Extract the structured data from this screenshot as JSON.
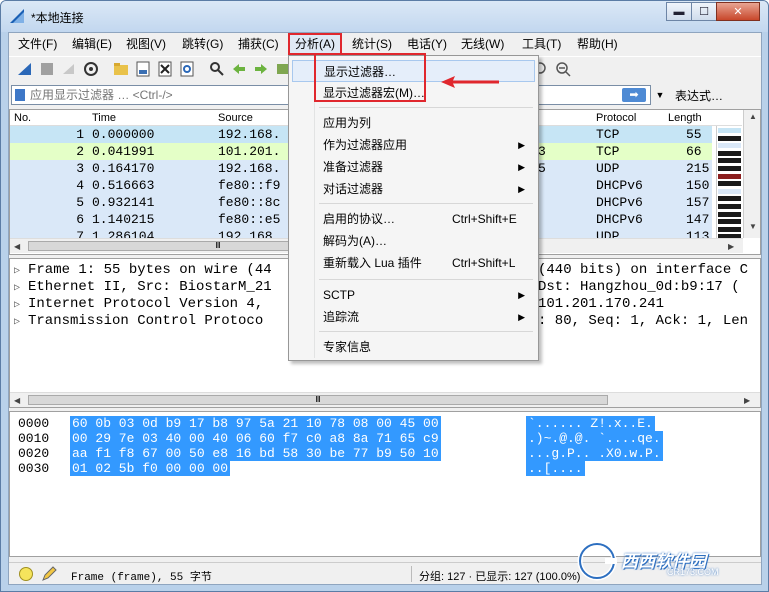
{
  "window": {
    "title": "*本地连接",
    "min": "▬",
    "max": "☐",
    "close": "✕"
  },
  "menubar": [
    "文件(F)",
    "编辑(E)",
    "视图(V)",
    "跳转(G)",
    "捕获(C)",
    "分析(A)",
    "统计(S)",
    "电话(Y)",
    "无线(W)",
    "工具(T)",
    "帮助(H)"
  ],
  "filter": {
    "placeholder": "应用显示过滤器 … <Ctrl-/>",
    "apply": "➡",
    "dropdown": "▼",
    "expression": "表达式…"
  },
  "packet_list": {
    "columns": [
      "No.",
      "Time",
      "Source",
      "Protocol",
      "Length"
    ],
    "rows": [
      {
        "no": "1",
        "time": "0.000000",
        "source": "192.168.",
        "dest": "",
        "protocol": "TCP",
        "length": "55"
      },
      {
        "no": "2",
        "time": "0.041991",
        "source": "101.201.",
        "dest": "3",
        "protocol": "TCP",
        "length": "66"
      },
      {
        "no": "3",
        "time": "0.164170",
        "source": "192.168.",
        "dest": "5",
        "protocol": "UDP",
        "length": "215"
      },
      {
        "no": "4",
        "time": "0.516663",
        "source": "fe80::f9",
        "dest": "",
        "protocol": "DHCPv6",
        "length": "150"
      },
      {
        "no": "5",
        "time": "0.932141",
        "source": "fe80::8c",
        "dest": "",
        "protocol": "DHCPv6",
        "length": "157"
      },
      {
        "no": "6",
        "time": "1.140215",
        "source": "fe80::e5",
        "dest": "",
        "protocol": "DHCPv6",
        "length": "147"
      },
      {
        "no": "7",
        "time": "1.286104",
        "source": "192.168.",
        "dest": "",
        "protocol": "UDP",
        "length": "113"
      }
    ],
    "colors": {
      "selected": "#c6e5f5",
      "tcp_green": "#e4ffc7",
      "udp_blue": "#dae8f8"
    }
  },
  "details": [
    {
      "left": "Frame 1: 55 bytes on wire (44",
      "right": "(440 bits) on interface C"
    },
    {
      "left": "Ethernet II, Src: BiostarM_21",
      "right": "Dst: Hangzhou_0d:b9:17 ("
    },
    {
      "left": "Internet Protocol Version 4,",
      "right": "101.201.170.241"
    },
    {
      "left": "Transmission Control Protoco",
      "right": ": 80, Seq: 1, Ack: 1, Len"
    }
  ],
  "hex": [
    {
      "offset": "0000",
      "bytes": "60 0b 03 0d b9 17 b8 97  5a 21 10 78 08 00 45 00",
      "ascii": "`...... Z!.x..E."
    },
    {
      "offset": "0010",
      "bytes": "00 29 7e 03 40 00 40 06  60 f7 c0 a8 8a 71 65 c9",
      "ascii": ".)~.@.@. `....qe."
    },
    {
      "offset": "0020",
      "bytes": "aa f1 f8 67 00 50 e8 16  bd 58 30 be 77 b9 50 10",
      "ascii": "...g.P.. .X0.w.P."
    },
    {
      "offset": "0030",
      "bytes": "01 02 5b f0 00 00 00",
      "ascii": "..[...."
    }
  ],
  "status": {
    "frame": "Frame (frame), 55 字节",
    "packets": "分组: 127 · 已显示: 127 (100.0%)"
  },
  "analyze_menu": {
    "items": [
      {
        "label": "显示过滤器…",
        "shortcut": "",
        "submenu": false
      },
      {
        "label": "显示过滤器宏(M)…",
        "shortcut": "",
        "submenu": false
      },
      {
        "label": "应用为列",
        "shortcut": "",
        "submenu": false
      },
      {
        "label": "作为过滤器应用",
        "shortcut": "",
        "submenu": true
      },
      {
        "label": "准备过滤器",
        "shortcut": "",
        "submenu": true
      },
      {
        "label": "对话过滤器",
        "shortcut": "",
        "submenu": true
      },
      {
        "label": "启用的协议…",
        "shortcut": "Ctrl+Shift+E",
        "submenu": false
      },
      {
        "label": "解码为(A)…",
        "shortcut": "",
        "submenu": false
      },
      {
        "label": "重新载入 Lua 插件",
        "shortcut": "Ctrl+Shift+L",
        "submenu": false
      },
      {
        "label": "SCTP",
        "shortcut": "",
        "submenu": true
      },
      {
        "label": "追踪流",
        "shortcut": "",
        "submenu": true
      },
      {
        "label": "专家信息",
        "shortcut": "",
        "submenu": false
      }
    ],
    "submenu_glyph": "▶",
    "accent": "#e0272d"
  },
  "watermark": {
    "text": "西西软件园",
    "sub": "CR173.COM"
  }
}
